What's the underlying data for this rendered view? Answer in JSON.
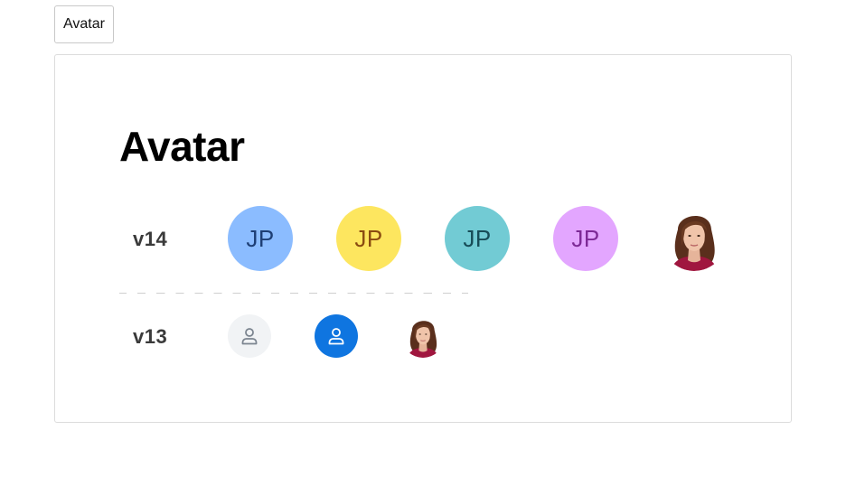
{
  "tab": {
    "label": "Avatar"
  },
  "page": {
    "title": "Avatar"
  },
  "rows": [
    {
      "label": "v14",
      "avatars": [
        {
          "kind": "initials",
          "text": "JP",
          "bg": "#8bbcff",
          "fg": "#1e3f75"
        },
        {
          "kind": "initials",
          "text": "JP",
          "bg": "#fde65f",
          "fg": "#8a4b10"
        },
        {
          "kind": "initials",
          "text": "JP",
          "bg": "#72cbd4",
          "fg": "#174c57"
        },
        {
          "kind": "initials",
          "text": "JP",
          "bg": "#e3a6ff",
          "fg": "#7d2a96"
        },
        {
          "kind": "photo",
          "icon": "woman-portrait-photo"
        }
      ]
    },
    {
      "label": "v13",
      "avatars": [
        {
          "kind": "icon",
          "icon": "user-icon",
          "bg": "#f1f3f5",
          "fg": "#7c8590"
        },
        {
          "kind": "icon",
          "icon": "user-icon",
          "bg": "#0f75e0",
          "fg": "#ffffff"
        },
        {
          "kind": "photo",
          "icon": "woman-portrait-photo"
        }
      ]
    }
  ]
}
